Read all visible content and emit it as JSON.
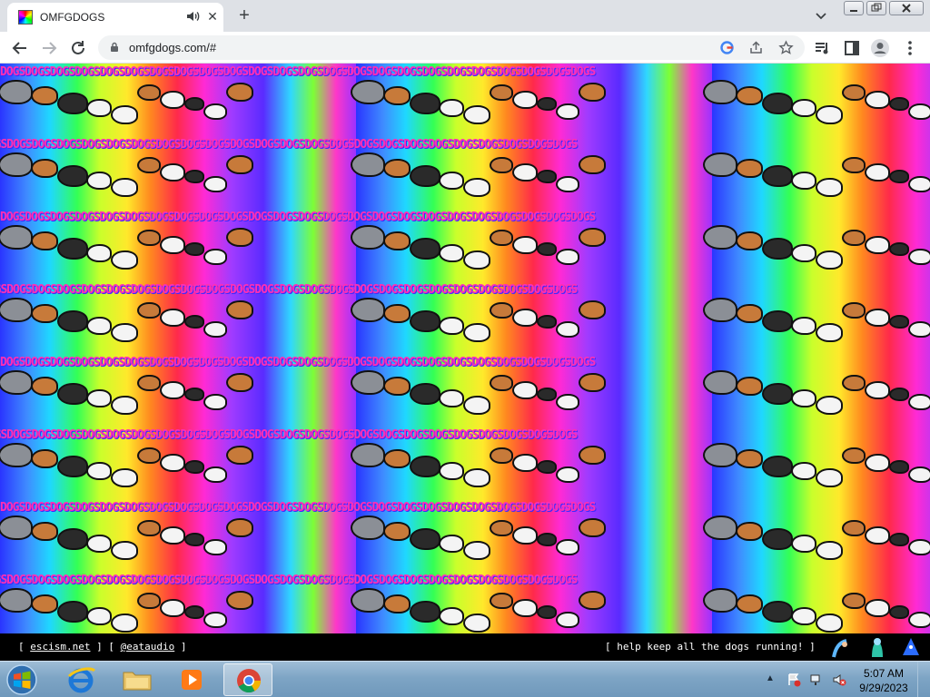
{
  "browser": {
    "tab_title": "OMFGDOGS",
    "url": "omfgdogs.com/#",
    "new_tab_symbol": "+",
    "close_symbol": "✕"
  },
  "page": {
    "band_text": "DOGSDOGSDOGSDOGSDOGSDOGSDOGSDOGSDOGSDOGSDOGSDOGSDOGSDOGSDOGSDOGSDOGSDOGSDOGSDOGSDOGSDOGSDOGSDOGS",
    "footer": {
      "bracket_open": "[ ",
      "bracket_close": " ]",
      "link1": "escism.net",
      "link2": "@eataudio",
      "right_text": "[ help keep all the dogs running! ]"
    }
  },
  "taskbar": {
    "time": "5:07 AM",
    "date": "9/29/2023"
  },
  "colors": {
    "tab_strip": "#dee1e6",
    "taskbar": "#7ea5c5",
    "dog_white": "#f4f4f4",
    "dog_brown": "#c77a3a",
    "dog_grey": "#8b8f96",
    "dog_black": "#2a2a2a"
  }
}
